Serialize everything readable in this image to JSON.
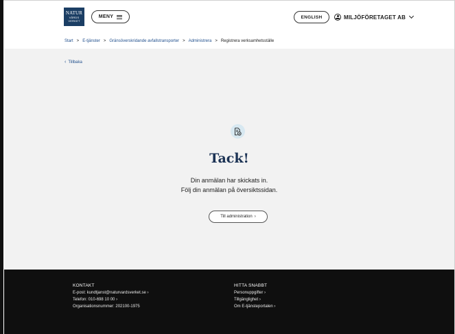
{
  "header": {
    "logo": {
      "line1": "NATUR",
      "line2": "VÅRDS",
      "line3": "VERKET"
    },
    "menu_label": "MENY",
    "language_label": "ENGLISH",
    "account_label": "MILJÖFÖRETAGET AB"
  },
  "breadcrumb": {
    "items": [
      "Start",
      "E-tjänster",
      "Gränsöverskridande avfallstransporter",
      "Administrera"
    ],
    "current": "Registrera verksamhetsställe",
    "separator": ">"
  },
  "main": {
    "back_label": "Tillbaka",
    "icon": "document-check-icon",
    "title": "Tack!",
    "message_line1": "Din anmälan har skickats in.",
    "message_line2": "Följ din anmälan på översiktssidan.",
    "admin_button_label": "Till administration",
    "admin_button_arrow": "›"
  },
  "footer": {
    "contact": {
      "heading": "KONTAKT",
      "email": "E-post: kundtjanst@naturvardsverket.se",
      "phone": "Telefon: 010-698 10 00",
      "org_number": "Organisationsnummer: 202100-1975"
    },
    "quick_links": {
      "heading": "HITTA SNABBT",
      "items": [
        "Personuppgifter",
        "Tillgänglighet",
        "Om E-tjänsteportalen"
      ]
    },
    "link_arrow": "›"
  },
  "colors": {
    "brand_navy": "#1b3e64",
    "link_blue": "#1f4e8c",
    "title_navy": "#1b3254",
    "content_bg": "#f2f2f2",
    "footer_bg": "#0f0f0f",
    "icon_circle": "#d7e8f1"
  }
}
